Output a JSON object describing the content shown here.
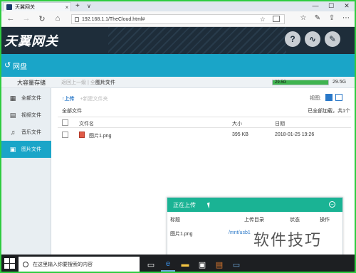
{
  "browser": {
    "tab_title": "天翼网关",
    "tab_close": "×",
    "new_tab": "+",
    "tab_dropdown": "∨",
    "url": "192.168.1.1/TheCloud.html#",
    "win_min": "—",
    "win_max": "☐",
    "win_close": "✕"
  },
  "app": {
    "logo": "天翼网关",
    "header_buttons": [
      "help-icon",
      "network-icon",
      "tools-icon"
    ],
    "pan_title": "网盘"
  },
  "storage": {
    "label": "大容量存储",
    "breadcrumb_prev": "返回上一级 | 全部文件",
    "breadcrumb_current": "图片文件",
    "used": "29.5G",
    "total": "29.5G",
    "used_fraction": 1.0
  },
  "sidebar": {
    "items": [
      {
        "label": "全部文件",
        "icon": "files-icon",
        "active": false
      },
      {
        "label": "视频文件",
        "icon": "video-icon",
        "active": false
      },
      {
        "label": "音乐文件",
        "icon": "music-icon",
        "active": false
      },
      {
        "label": "图片文件",
        "icon": "image-icon",
        "active": true
      }
    ]
  },
  "main": {
    "upload_btn": "↑上传",
    "newfolder_btn": "+新建文件夹",
    "view_label": "视图:",
    "all_files": "全部文件",
    "loaded_status": "已全部加载，共1个",
    "columns": {
      "name": "文件名",
      "size": "大小",
      "date": "日期"
    },
    "rows": [
      {
        "name": "图片1.png",
        "size": "395 KB",
        "date": "2018-01-25 19:26"
      }
    ]
  },
  "upload_panel": {
    "title": "正在上传",
    "minimize": "–",
    "columns": {
      "title": "标题",
      "dir": "上传目录",
      "status": "状态",
      "action": "操作"
    },
    "rows": [
      {
        "title": "图片1.png",
        "dir": "/mnt/usb1"
      }
    ]
  },
  "watermark": "软件技巧",
  "taskbar": {
    "search_placeholder": "在这里输入你要搜索的内容"
  },
  "colors": {
    "teal": "#1aa5c8",
    "upload_header": "#1ab394",
    "storage_fill": "#3fb44f",
    "frame": "#2ecc40"
  }
}
